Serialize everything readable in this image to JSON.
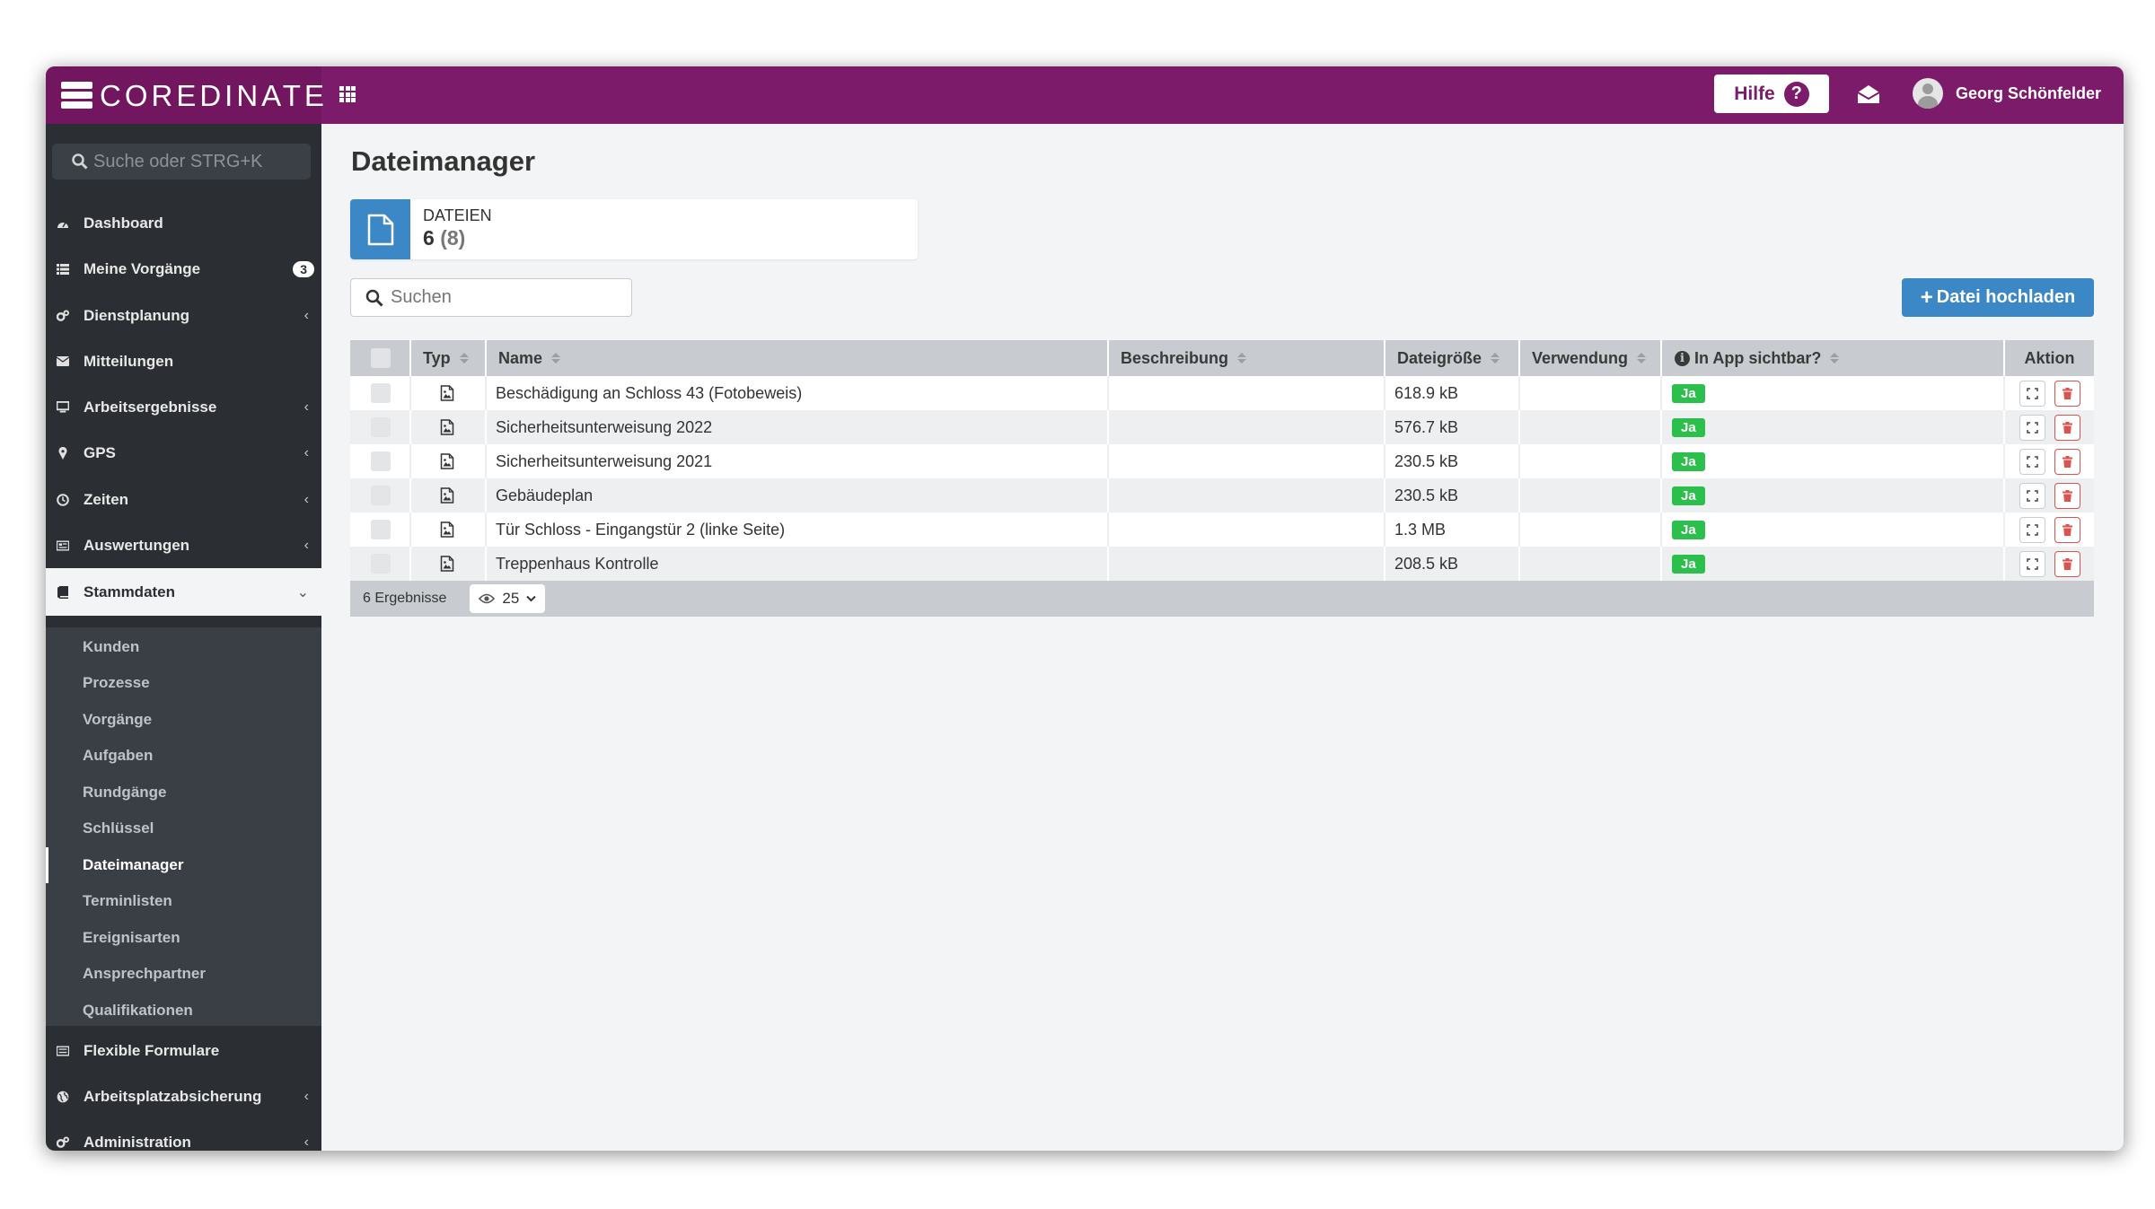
{
  "app": {
    "name": "COREDINATE",
    "help_label": "Hilfe",
    "help_symbol": "?",
    "user_name": "Georg Schönfelder"
  },
  "sidebar": {
    "search_placeholder": "Suche oder STRG+K",
    "items": [
      {
        "label": "Dashboard",
        "icon": "dashboard-icon"
      },
      {
        "label": "Meine Vorgänge",
        "icon": "list-icon",
        "badge": "3"
      },
      {
        "label": "Dienstplanung",
        "icon": "cogs-icon",
        "chevron": "‹"
      },
      {
        "label": "Mitteilungen",
        "icon": "envelope-icon"
      },
      {
        "label": "Arbeitsergebnisse",
        "icon": "monitor-icon",
        "chevron": "‹"
      },
      {
        "label": "GPS",
        "icon": "map-pin-icon",
        "chevron": "‹"
      },
      {
        "label": "Zeiten",
        "icon": "clock-icon",
        "chevron": "‹"
      },
      {
        "label": "Auswertungen",
        "icon": "report-icon",
        "chevron": "‹"
      },
      {
        "label": "Stammdaten",
        "icon": "book-icon",
        "chevron": "⌄"
      },
      {
        "label": "Flexible Formulare",
        "icon": "form-icon"
      },
      {
        "label": "Arbeitsplatzabsicherung",
        "icon": "globe-icon",
        "chevron": "‹"
      },
      {
        "label": "Administration",
        "icon": "cogs-icon",
        "chevron": "‹"
      }
    ],
    "sub_items": [
      "Kunden",
      "Prozesse",
      "Vorgänge",
      "Aufgaben",
      "Rundgänge",
      "Schlüssel",
      "Dateimanager",
      "Terminlisten",
      "Ereignisarten",
      "Ansprechpartner",
      "Qualifikationen"
    ]
  },
  "main": {
    "title": "Dateimanager",
    "stat": {
      "label": "DATEIEN",
      "count": "6",
      "total": "(8)"
    },
    "search_placeholder": "Suchen",
    "upload_label": "Datei hochladen",
    "table": {
      "headers": {
        "type": "Typ",
        "name": "Name",
        "description": "Beschreibung",
        "size": "Dateigröße",
        "usage": "Verwendung",
        "visible": "In App sichtbar?",
        "action": "Aktion"
      },
      "rows": [
        {
          "name": "Beschädigung an Schloss 43 (Fotobeweis)",
          "description": "",
          "size": "618.9 kB",
          "usage": "",
          "visible": "Ja"
        },
        {
          "name": "Sicherheitsunterweisung 2022",
          "description": "",
          "size": "576.7 kB",
          "usage": "",
          "visible": "Ja"
        },
        {
          "name": "Sicherheitsunterweisung 2021",
          "description": "",
          "size": "230.5 kB",
          "usage": "",
          "visible": "Ja"
        },
        {
          "name": "Gebäudeplan",
          "description": "",
          "size": "230.5 kB",
          "usage": "",
          "visible": "Ja"
        },
        {
          "name": "Tür Schloss - Eingangstür 2 (linke Seite)",
          "description": "",
          "size": "1.3 MB",
          "usage": "",
          "visible": "Ja"
        },
        {
          "name": "Treppenhaus Kontrolle",
          "description": "",
          "size": "208.5 kB",
          "usage": "",
          "visible": "Ja"
        }
      ],
      "result_count": "6 Ergebnisse",
      "per_page": "25"
    }
  },
  "colors": {
    "brand": "#7b1b6a",
    "primary": "#3c87c5",
    "success": "#2bbf4b",
    "danger": "#d9534f",
    "sidebar": "#2b2f34"
  }
}
